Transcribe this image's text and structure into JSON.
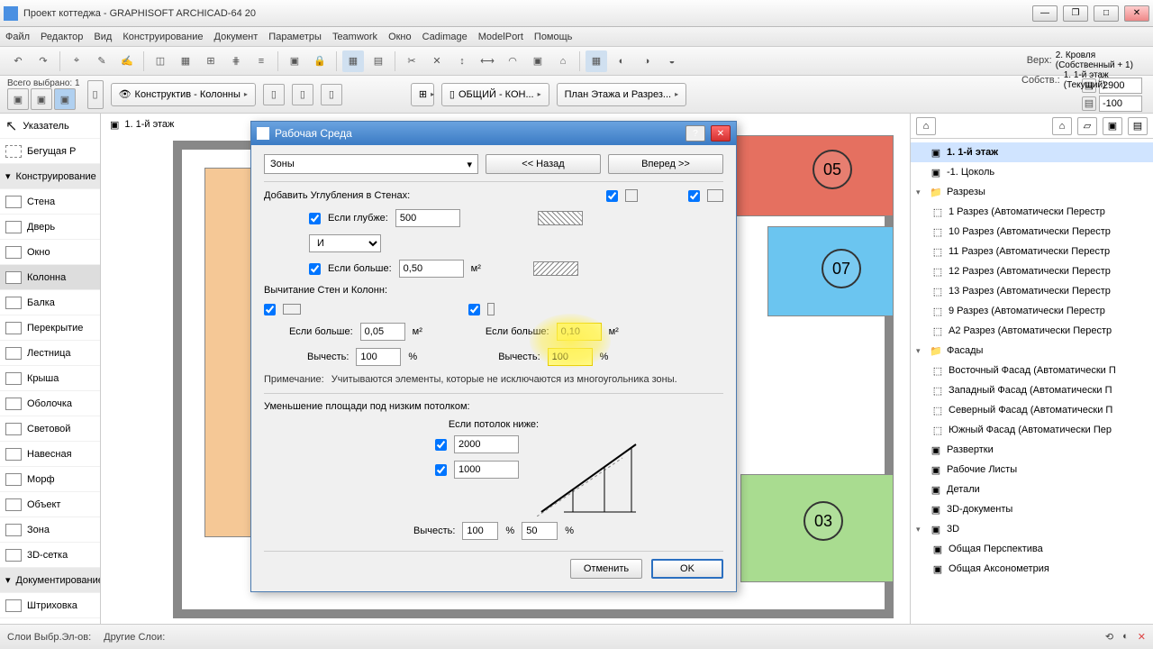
{
  "window": {
    "title": "Проект коттеджа - GRAPHISOFT ARCHICAD-64 20"
  },
  "menu": {
    "file": "Файл",
    "editor": "Редактор",
    "view": "Вид",
    "construction": "Конструирование",
    "document": "Документ",
    "parameters": "Параметры",
    "teamwork": "Teamwork",
    "window": "Окно",
    "cadimage": "Cadimage",
    "modelport": "ModelPort",
    "help": "Помощь"
  },
  "toolbar2": {
    "selected_label": "Всего выбрано: 1",
    "layer_combo": "Конструктив - Колонны",
    "combo2": "ОБЩИЙ - КОН...",
    "combo3": "План Этажа и Разрез...",
    "floor_up_label": "Верх:",
    "floor_up": "2. Кровля (Собственный + 1)",
    "floor_down_label": "Собств.:",
    "floor_down": "1. 1-й этаж (Текущий)",
    "val_up": "2900",
    "val_down": "-100"
  },
  "tab": {
    "label": "1. 1-й этаж"
  },
  "left_tools": {
    "pointer": "Указатель",
    "marquee": "Бегущая Р",
    "constr_header": "Конструирование",
    "wall": "Стена",
    "door": "Дверь",
    "window": "Окно",
    "column": "Колонна",
    "beam": "Балка",
    "slab": "Перекрытие",
    "stair": "Лестница",
    "roof": "Крыша",
    "shell": "Оболочка",
    "skylight": "Световой",
    "curtain": "Навесная",
    "morph": "Морф",
    "object": "Объект",
    "zone": "Зона",
    "mesh": "3D-сетка",
    "doc_header": "Документирование",
    "fill": "Штриховка",
    "line": "Линия"
  },
  "zones": {
    "z05": "05",
    "z07": "07",
    "z03": "03"
  },
  "tree": {
    "root": "1. 1-й этаж",
    "basement": "-1. Цоколь",
    "sections": "Разрезы",
    "sec_items": [
      "1 Разрез (Автоматически Перестр",
      "10 Разрез (Автоматически Перестр",
      "11 Разрез (Автоматически Перестр",
      "12 Разрез (Автоматически Перестр",
      "13 Разрез (Автоматически Перестр",
      "9 Разрез (Автоматически Перестр",
      "A2 Разрез (Автоматически Перестр"
    ],
    "facades": "Фасады",
    "fac_items": [
      "Восточный Фасад (Автоматически П",
      "Западный Фасад (Автоматически П",
      "Северный Фасад (Автоматически П",
      "Южный Фасад (Автоматически Пер"
    ],
    "razvertki": "Развертки",
    "worksheets": "Рабочие Листы",
    "details": "Детали",
    "docs3d": "3D-документы",
    "node3d": "3D",
    "perspective": "Общая Перспектива",
    "axon": "Общая Аксонометрия"
  },
  "dialog": {
    "title": "Рабочая Среда",
    "dropdown": "Зоны",
    "back": "<< Назад",
    "forward": "Вперед >>",
    "add_recesses": "Добавить Углубления в Стенах:",
    "if_deeper": "Если глубже:",
    "val_deeper": "500",
    "and": "И",
    "if_larger": "Если больше:",
    "val_larger_1": "0,50",
    "unit_m2": "м²",
    "section_subtraction": "Вычитание Стен и Колонн:",
    "if_larger_2_lbl": "Если больше:",
    "val_larger_2": "0,05",
    "subtract_lbl": "Вычесть:",
    "val_subtract_1": "100",
    "pct": "%",
    "if_larger_3_lbl": "Если больше:",
    "val_larger_3": "0,10",
    "val_subtract_2": "100",
    "note_lbl": "Примечание:",
    "note_text": "Учитываются элементы, которые не исключаются из многоугольника зоны.",
    "low_ceiling": "Уменьшение площади под низким потолком:",
    "if_ceiling": "Если потолок ниже:",
    "val_c1": "2000",
    "val_c2": "1000",
    "subtract2_lbl": "Вычесть:",
    "val_s1": "100",
    "val_s2": "50",
    "cancel": "Отменить",
    "ok": "OK"
  },
  "status": {
    "layers_sel": "Слои Выбр.Эл-ов:",
    "other_layers": "Другие Слои:"
  }
}
